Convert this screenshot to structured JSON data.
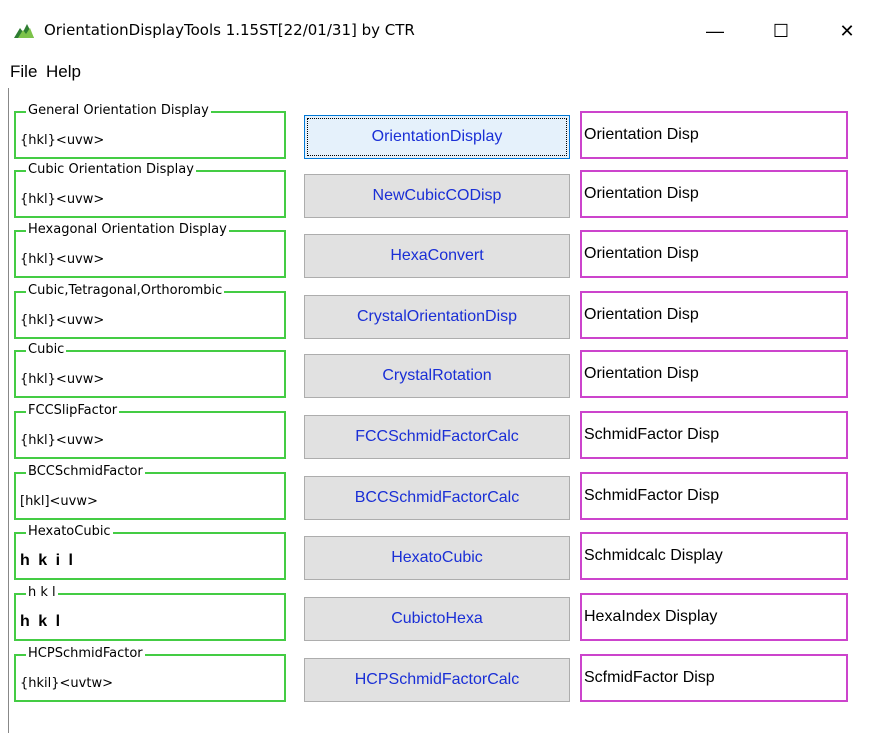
{
  "window": {
    "title": "OrientationDisplayTools 1.15ST[22/01/31] by CTR",
    "icon": "app-icon",
    "minimize_symbol": "—",
    "maximize_symbol": "☐",
    "close_symbol": "✕"
  },
  "menu": {
    "file": "File",
    "help": "Help"
  },
  "colors": {
    "group_border": "#44cc44",
    "display_border": "#cc44cc",
    "button_text": "#1a2fd6"
  },
  "rows": [
    {
      "group_title": "General Orientation Display",
      "group_text": "{hkl}<uvw>",
      "button": "OrientationDisplay",
      "display": "Orientation Disp"
    },
    {
      "group_title": "Cubic Orientation Display",
      "group_text": "{hkl}<uvw>",
      "button": "NewCubicCODisp",
      "display": "Orientation Disp"
    },
    {
      "group_title": "Hexagonal Orientation Display",
      "group_text": "{hkl}<uvw>",
      "button": "HexaConvert",
      "display": "Orientation Disp"
    },
    {
      "group_title": "Cubic,Tetragonal,Orthorombic",
      "group_text": "{hkl}<uvw>",
      "button": "CrystalOrientationDisp",
      "display": "Orientation Disp"
    },
    {
      "group_title": "Cubic",
      "group_text": "{hkl}<uvw>",
      "button": "CrystalRotation",
      "display": "Orientation Disp"
    },
    {
      "group_title": "FCCSlipFactor",
      "group_text": "{hkl}<uvw>",
      "button": "FCCSchmidFactorCalc",
      "display": "SchmidFactor Disp"
    },
    {
      "group_title": "BCCSchmidFactor",
      "group_text": "[hkl]<uvw>",
      "button": "BCCSchmidFactorCalc",
      "display": "SchmidFactor Disp"
    },
    {
      "group_title": "HexatoCubic",
      "group_text": "h k i l",
      "button": "HexatoCubic",
      "display": "Schmidcalc Display"
    },
    {
      "group_title": "h k l",
      "group_text": "h k l",
      "button": "CubictoHexa",
      "display": "HexaIndex Display"
    },
    {
      "group_title": "HCPSchmidFactor",
      "group_text": "{hkil}<uvtw>",
      "button": "HCPSchmidFactorCalc",
      "display": "ScfmidFactor Disp"
    }
  ]
}
